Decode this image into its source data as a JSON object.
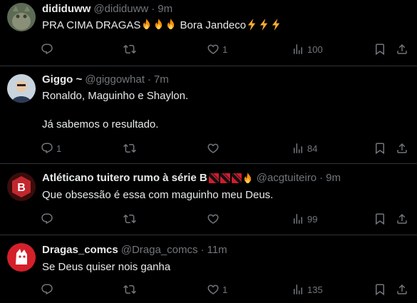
{
  "tweets": [
    {
      "name": "dididuww",
      "handle": "@dididuww",
      "time": "9m",
      "text": "PRA CIMA DRAGAS",
      "text_after": "Bora Jandeco",
      "reply_count": "",
      "like_count": "1",
      "view_count": "100"
    },
    {
      "name": "Giggo ~",
      "handle": "@giggowhat",
      "time": "7m",
      "line1": "Ronaldo, Maguinho e Shaylon.",
      "line2": "Já sabemos o resultado.",
      "reply_count": "1",
      "like_count": "",
      "view_count": "84"
    },
    {
      "name": "Atléticano tuitero rumo à série B",
      "handle": "@acgtuiteiro",
      "time": "9m",
      "text": "Que obsessão é essa com maguinho meu Deus.",
      "reply_count": "",
      "like_count": "",
      "view_count": "99",
      "avatar_letter": "B"
    },
    {
      "name": "Dragas_comcs",
      "handle": "@Draga_comcs",
      "time": "11m",
      "text": "Se Deus quiser nois ganha",
      "reply_count": "",
      "like_count": "1",
      "view_count": "135"
    }
  ],
  "separator": "·",
  "colors": {
    "background": "#000000",
    "text": "#e7e9ea",
    "muted": "#71767b",
    "divider": "#2f3336"
  },
  "icons": [
    "reply-icon",
    "retweet-icon",
    "like-icon",
    "views-icon",
    "bookmark-icon",
    "share-icon",
    "fire-emoji",
    "lightning-emoji",
    "flag-emoji"
  ]
}
